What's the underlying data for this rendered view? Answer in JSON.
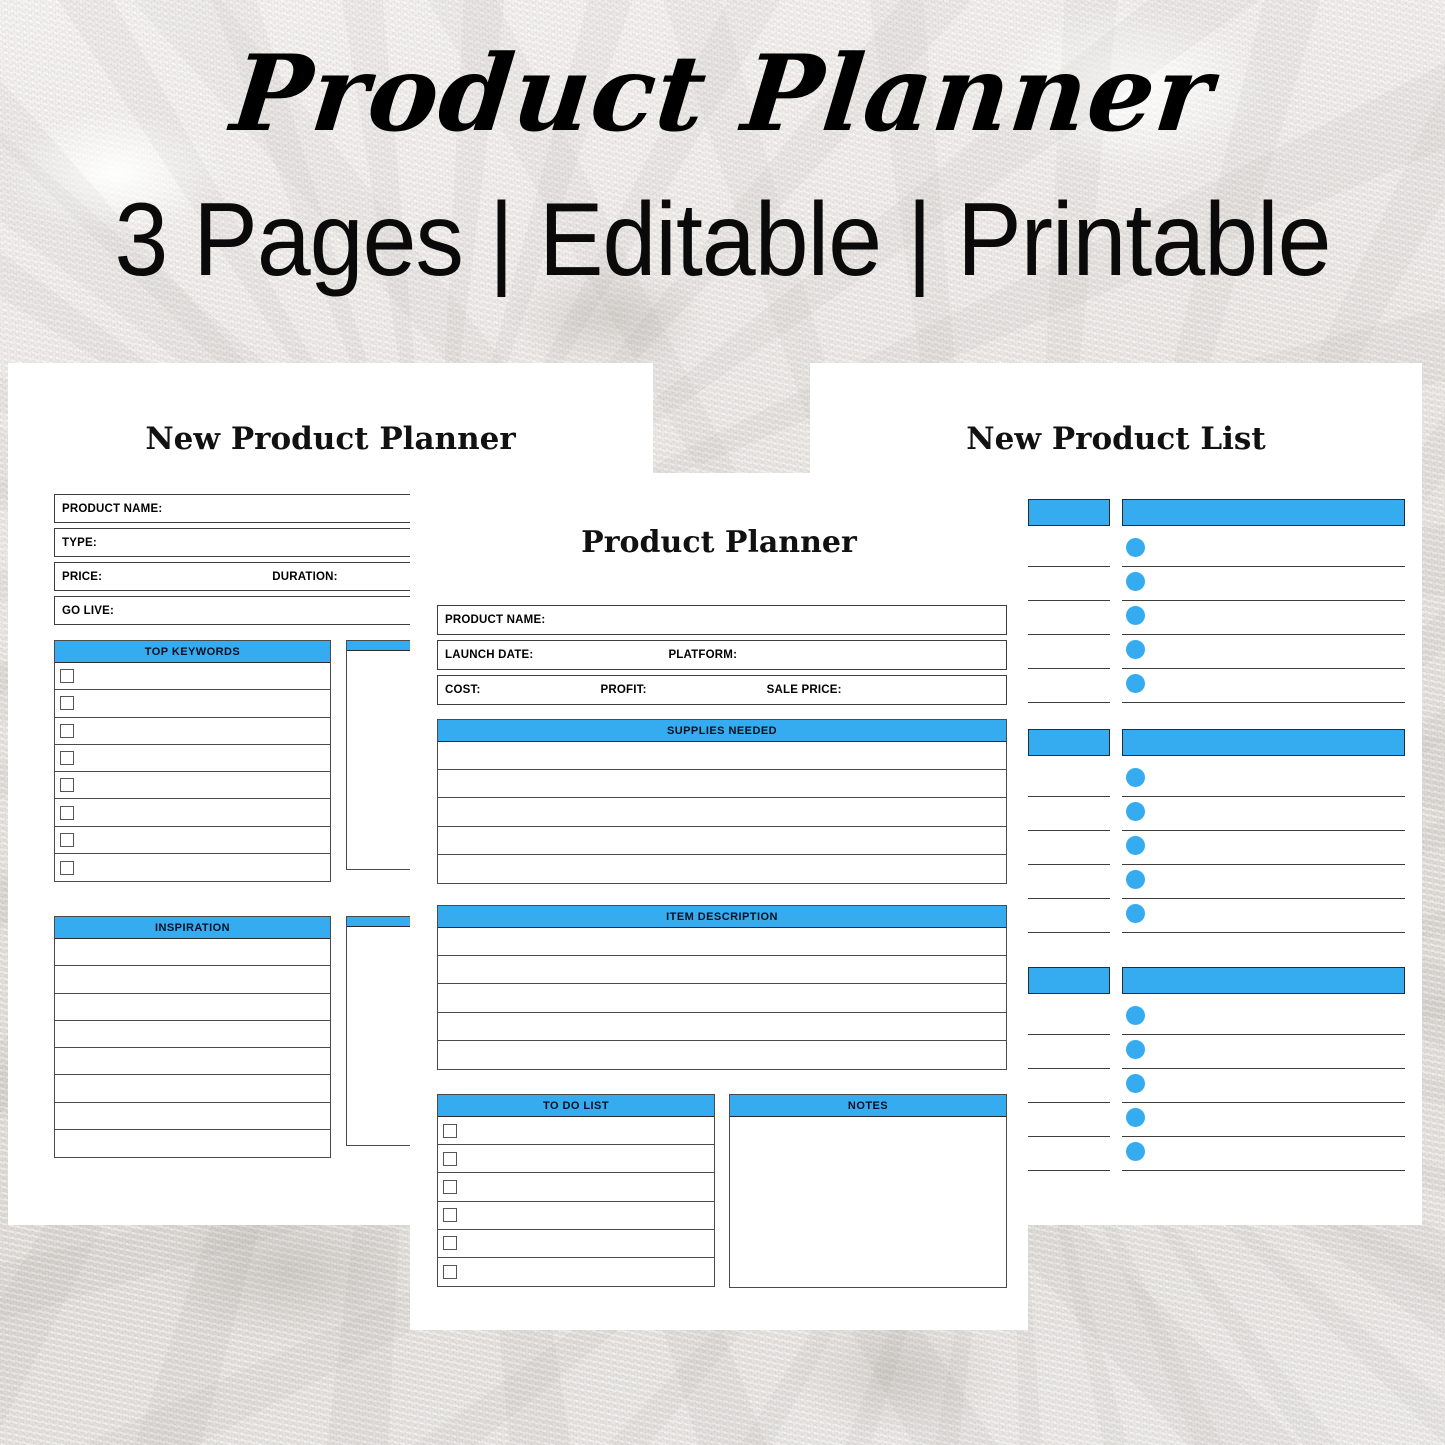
{
  "hero": {
    "script_title": "Product Planner",
    "subtitle": "3 Pages | Editable | Printable"
  },
  "theme": {
    "accent_blue": "#35ACF0",
    "page_white": "#FFFFFF",
    "line_dark": "#3D3D3D"
  },
  "pages": [
    {
      "id": "new-product-planner",
      "title": "New Product Planner",
      "fields": [
        {
          "label": "PRODUCT NAME:",
          "value": ""
        },
        {
          "label": "TYPE:",
          "value": ""
        },
        {
          "label": "PRICE:",
          "label2": "DURATION:",
          "value": ""
        },
        {
          "label": "GO LIVE:",
          "value": ""
        }
      ],
      "sections": [
        {
          "header": "TOP KEYWORDS",
          "rows": 8,
          "checkbox": true
        },
        {
          "header": "",
          "rows": 0,
          "checkbox": false,
          "side": true
        },
        {
          "header": "INSPIRATION",
          "rows": 8,
          "checkbox": false
        },
        {
          "header": "",
          "rows": 0,
          "checkbox": false,
          "side": true
        }
      ]
    },
    {
      "id": "product-planner",
      "title": "Product Planner",
      "fields": [
        {
          "label": "PRODUCT NAME:",
          "value": ""
        },
        {
          "label": "LAUNCH DATE:",
          "label2": "PLATFORM:",
          "value": ""
        },
        {
          "label": "COST:",
          "label2": "PROFIT:",
          "label3": "SALE PRICE:",
          "value": ""
        }
      ],
      "sections": [
        {
          "header": "SUPPLIES NEEDED",
          "rows": 5,
          "checkbox": false
        },
        {
          "header": "ITEM DESCRIPTION",
          "rows": 5,
          "checkbox": false
        },
        {
          "header": "TO DO LIST",
          "rows": 6,
          "checkbox": true
        },
        {
          "header": "NOTES",
          "rows": 0,
          "checkbox": false,
          "open": true
        }
      ]
    },
    {
      "id": "new-product-list",
      "title": "New Product List",
      "groups": [
        {
          "header_small": "",
          "header_large": "",
          "rows": 5
        },
        {
          "header_small": "",
          "header_large": "",
          "rows": 5
        },
        {
          "header_small": "",
          "header_large": "",
          "rows": 5
        }
      ]
    }
  ]
}
